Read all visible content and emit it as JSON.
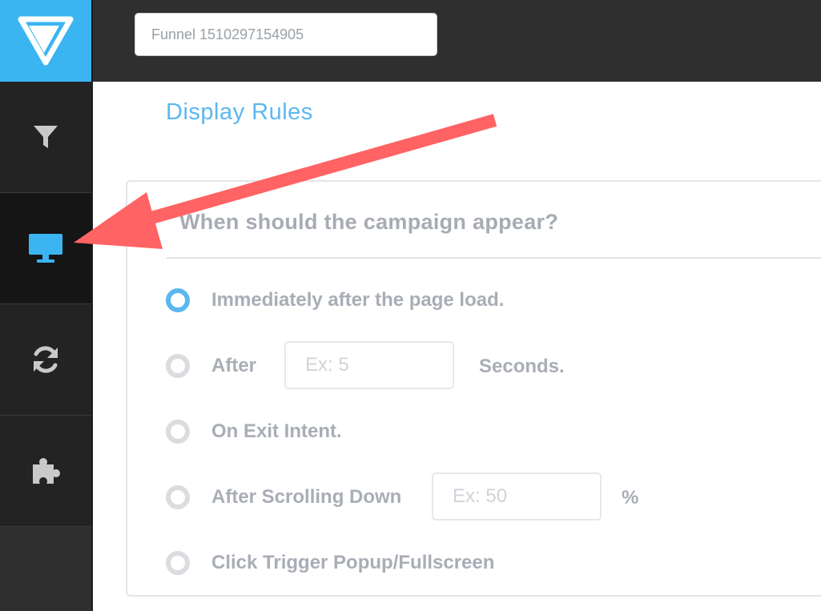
{
  "topbar": {
    "funnel_name": "Funnel 1510297154905"
  },
  "sidebar": {
    "logo_icon": "brand-logo-icon",
    "items": [
      {
        "icon": "filter-icon",
        "active": false
      },
      {
        "icon": "monitor-icon",
        "active": true
      },
      {
        "icon": "refresh-icon",
        "active": false
      },
      {
        "icon": "puzzle-icon",
        "active": false
      }
    ]
  },
  "main": {
    "title": "Display Rules",
    "card_title": "When should the campaign appear?",
    "options": [
      {
        "label": "Immediately after the page load.",
        "selected": true
      },
      {
        "label": "After",
        "selected": false,
        "input_placeholder": "Ex: 5",
        "suffix": "Seconds."
      },
      {
        "label": "On Exit Intent.",
        "selected": false
      },
      {
        "label": "After Scrolling Down",
        "selected": false,
        "input_placeholder": "Ex: 50",
        "suffix": "%"
      },
      {
        "label": "Click Trigger Popup/Fullscreen",
        "selected": false
      }
    ]
  },
  "colors": {
    "accent": "#5bb8ef",
    "logo_bg": "#3ab5f2",
    "annotation_arrow": "#ff6363",
    "sidebar_bg": "#232323"
  }
}
